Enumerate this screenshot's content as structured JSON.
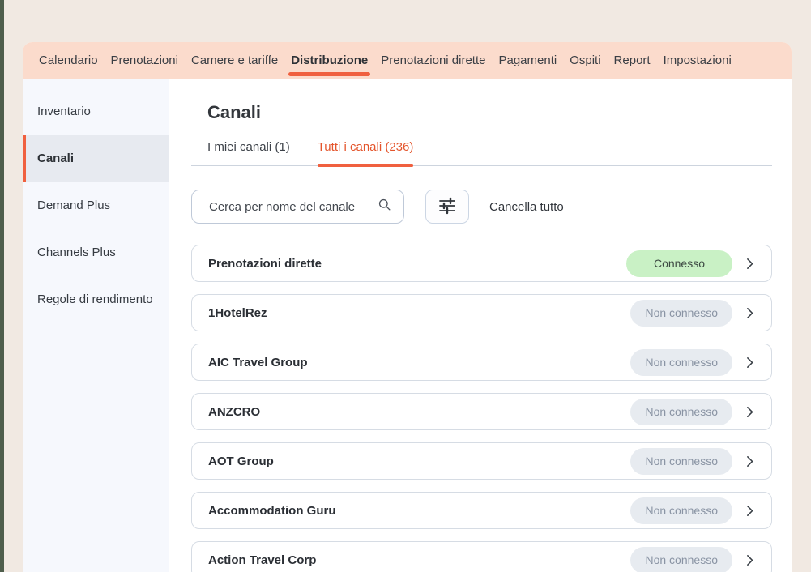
{
  "nav": {
    "items": [
      {
        "label": "Calendario",
        "active": false
      },
      {
        "label": "Prenotazioni",
        "active": false
      },
      {
        "label": "Camere e tariffe",
        "active": false
      },
      {
        "label": "Distribuzione",
        "active": true
      },
      {
        "label": "Prenotazioni dirette",
        "active": false
      },
      {
        "label": "Pagamenti",
        "active": false
      },
      {
        "label": "Ospiti",
        "active": false
      },
      {
        "label": "Report",
        "active": false
      },
      {
        "label": "Impostazioni",
        "active": false
      }
    ]
  },
  "sidebar": {
    "items": [
      {
        "label": "Inventario",
        "active": false
      },
      {
        "label": "Canali",
        "active": true
      },
      {
        "label": "Demand Plus",
        "active": false
      },
      {
        "label": "Channels Plus",
        "active": false
      },
      {
        "label": "Regole di rendimento",
        "active": false
      }
    ]
  },
  "main": {
    "title": "Canali",
    "tabs": [
      {
        "label": "I miei canali (1)",
        "active": false
      },
      {
        "label": "Tutti i canali (236)",
        "active": true
      }
    ],
    "search": {
      "placeholder": "Cerca per nome del canale"
    },
    "clear_all_label": "Cancella tutto",
    "channels": [
      {
        "name": "Prenotazioni dirette",
        "status": "Connesso",
        "connected": true
      },
      {
        "name": "1HotelRez",
        "status": "Non connesso",
        "connected": false
      },
      {
        "name": "AIC Travel Group",
        "status": "Non connesso",
        "connected": false
      },
      {
        "name": "ANZCRO",
        "status": "Non connesso",
        "connected": false
      },
      {
        "name": "AOT Group",
        "status": "Non connesso",
        "connected": false
      },
      {
        "name": "Accommodation Guru",
        "status": "Non connesso",
        "connected": false
      },
      {
        "name": "Action Travel Corp",
        "status": "Non connesso",
        "connected": false
      }
    ]
  },
  "icons": {
    "search": "search-icon",
    "filter": "sliders-icon",
    "row_arrow": "chevron-right-icon"
  },
  "colors": {
    "page_bg": "#f1e9e2",
    "edge_strip": "#4f5e4c",
    "nav_bg": "#fbdbcc",
    "accent_orange": "#f0603f",
    "active_tab_text": "#e4552c",
    "sidebar_bg": "#f6f8fd",
    "sidebar_active_bg": "#e7eaf0",
    "connected_badge_bg": "#c9f1c5",
    "disconnected_badge_bg": "#e7ebf0",
    "card_border": "#d6dce4"
  }
}
